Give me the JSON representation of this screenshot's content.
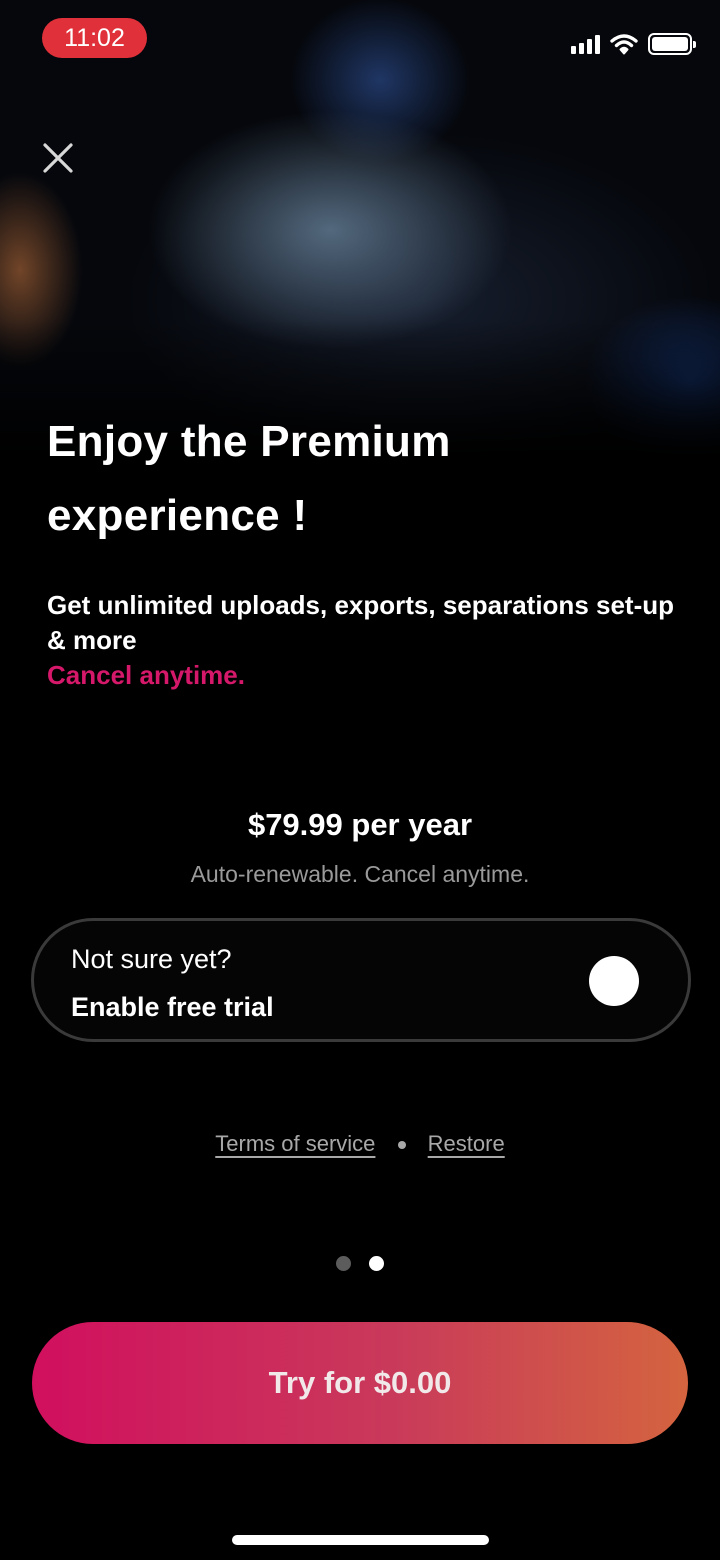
{
  "status_bar": {
    "time": "11:02"
  },
  "hero": {
    "title": "Enjoy the Premium experience !",
    "subtitle": "Get unlimited uploads, exports, separations set-up & more",
    "highlight": "Cancel anytime."
  },
  "plan": {
    "price": "$79.99 per year",
    "note": "Auto-renewable. Cancel anytime."
  },
  "trial": {
    "question": "Not sure yet?",
    "label": "Enable free trial",
    "enabled": false
  },
  "links": {
    "terms": "Terms of service",
    "restore": "Restore"
  },
  "pager": {
    "count": 2,
    "active_index": 1
  },
  "cta": {
    "label": "Try for $0.00"
  },
  "colors": {
    "accent": "#d6186a",
    "cta_start": "#d10f5e",
    "cta_end": "#d4643f",
    "status_pill": "#e0303a"
  },
  "icons": [
    "close-icon",
    "signal-icon",
    "wifi-icon",
    "battery-icon"
  ]
}
